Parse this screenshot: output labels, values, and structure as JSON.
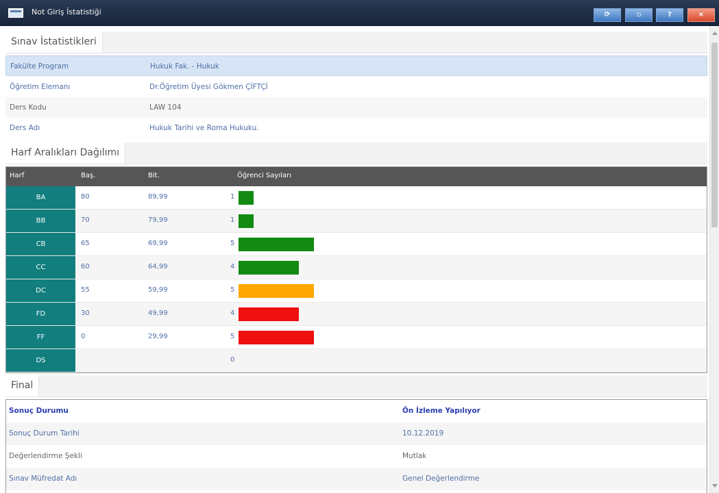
{
  "window": {
    "title": "Not Giriş İstatistiği",
    "buttons": {
      "refresh_icon": "refresh-icon",
      "restore_icon": "restore-icon",
      "help": "?",
      "close": "×"
    }
  },
  "exam_stats": {
    "header": "Sınav İstatistikleri",
    "rows": [
      {
        "label": "Fakülte Program",
        "value": "Hukuk Fak. - Hukuk"
      },
      {
        "label": "Öğretim Elemanı",
        "value": "Dr.Öğretim Üyesi Gökmen ÇİFTÇİ"
      },
      {
        "label": "Ders Kodu",
        "value": "LAW 104"
      },
      {
        "label": "Ders Adı",
        "value": "Hukuk Tarihi ve Roma Hukuku."
      }
    ]
  },
  "grade_distribution": {
    "header": "Harf Aralıkları Dağılımı",
    "columns": {
      "harf": "Harf",
      "bas": "Baş.",
      "bit": "Bit.",
      "count": "Öğrenci Sayıları"
    },
    "rows": [
      {
        "harf": "BA",
        "bas": "80",
        "bit": "89,99",
        "count": "1",
        "bar_value": 1,
        "color": "#138a13"
      },
      {
        "harf": "BB",
        "bas": "70",
        "bit": "79,99",
        "count": "1",
        "bar_value": 1,
        "color": "#138a13"
      },
      {
        "harf": "CB",
        "bas": "65",
        "bit": "69,99",
        "count": "5",
        "bar_value": 5,
        "color": "#138a13"
      },
      {
        "harf": "CC",
        "bas": "60",
        "bit": "64,99",
        "count": "4",
        "bar_value": 4,
        "color": "#138a13"
      },
      {
        "harf": "DC",
        "bas": "55",
        "bit": "59,99",
        "count": "5",
        "bar_value": 5,
        "color": "#ffa600"
      },
      {
        "harf": "FD",
        "bas": "30",
        "bit": "49,99",
        "count": "4",
        "bar_value": 4,
        "color": "#ef1010"
      },
      {
        "harf": "FF",
        "bas": "0",
        "bit": "29,99",
        "count": "5",
        "bar_value": 5,
        "color": "#ef1010"
      },
      {
        "harf": "DS",
        "bas": "",
        "bit": "",
        "count": "0",
        "bar_value": 0,
        "color": ""
      }
    ]
  },
  "final": {
    "header": "Final",
    "rows": [
      {
        "label": "Sonuç Durumu",
        "value": "Ön İzleme Yapılıyor"
      },
      {
        "label": "Sonuç Durum Tarihi",
        "value": "10.12.2019"
      },
      {
        "label": "Değerlendirme Şekli",
        "value": "Mutlak"
      },
      {
        "label": "Sınav Müfredat Adı",
        "value": "Genel Değerlendirme"
      }
    ]
  }
}
